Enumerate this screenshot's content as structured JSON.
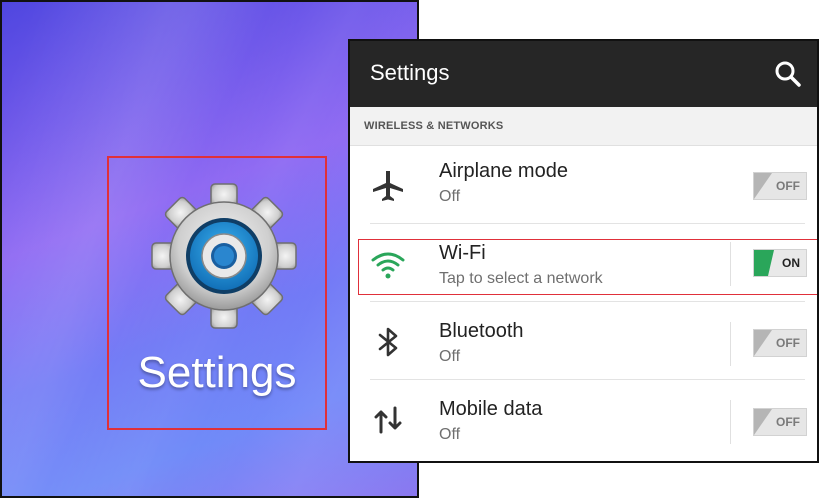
{
  "home": {
    "app_label": "Settings",
    "icon": "settings-gear-icon"
  },
  "settings": {
    "title": "Settings",
    "search_icon": "search-icon",
    "section_header": "WIRELESS & NETWORKS",
    "items": [
      {
        "title": "Airplane mode",
        "subtitle": "Off",
        "icon": "airplane-icon",
        "toggle": "OFF",
        "on": false
      },
      {
        "title": "Wi-Fi",
        "subtitle": "Tap to select a network",
        "icon": "wifi-icon",
        "toggle": "ON",
        "on": true
      },
      {
        "title": "Bluetooth",
        "subtitle": "Off",
        "icon": "bluetooth-icon",
        "toggle": "OFF",
        "on": false
      },
      {
        "title": "Mobile data",
        "subtitle": "Off",
        "icon": "mobile-data-icon",
        "toggle": "OFF",
        "on": false
      }
    ]
  },
  "colors": {
    "highlight": "#e0303a",
    "action_bar": "#262626",
    "wifi_green": "#2aa65a",
    "gear_blue": "#1a8fd6"
  }
}
